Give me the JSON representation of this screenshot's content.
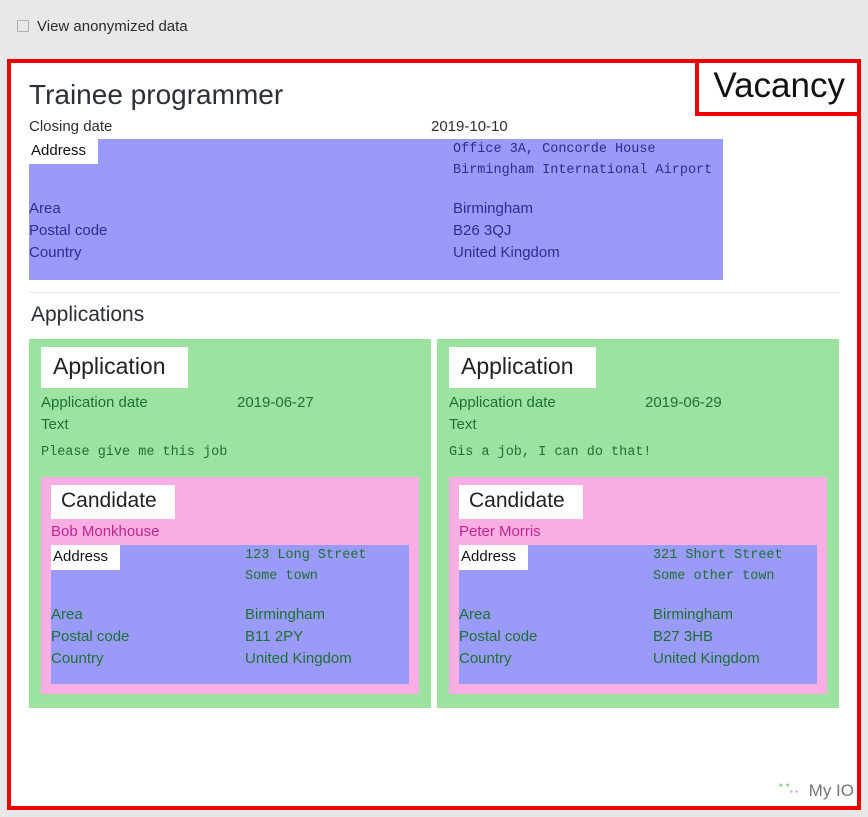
{
  "toolbar": {
    "anonymize_checkbox_label": "View anonymized data",
    "anonymize_checked": false
  },
  "colors": {
    "frame": "#ee0000",
    "address_block": "#9a9af8",
    "address_text": "#2d2d92",
    "application_block": "#9ce2a1",
    "application_text": "#1f7036",
    "candidate_block": "#fbaee4",
    "candidate_text": "#c0268f",
    "page_background": "#e8e8e8"
  },
  "vacancy": {
    "type_tag": "Vacancy",
    "title": "Trainee programmer",
    "closing_date_label": "Closing date",
    "closing_date_value": "2019-10-10",
    "address": {
      "section_label": "Address",
      "street_lines": [
        "Office 3A, Concorde House",
        "Birmingham International Airport"
      ],
      "area_label": "Area",
      "area_value": "Birmingham",
      "postal_code_label": "Postal code",
      "postal_code_value": "B26 3QJ",
      "country_label": "Country",
      "country_value": "United Kingdom"
    }
  },
  "applications_section": {
    "title": "Applications",
    "items": [
      {
        "type_tag": "Application",
        "date_label": "Application date",
        "date_value": "2019-06-27",
        "text_label": "Text",
        "text_value": "Please give me this job",
        "candidate": {
          "type_tag": "Candidate",
          "name": "Bob Monkhouse",
          "address": {
            "section_label": "Address",
            "street_lines": [
              "123 Long Street",
              "Some town"
            ],
            "area_label": "Area",
            "area_value": "Birmingham",
            "postal_code_label": "Postal code",
            "postal_code_value": "B11 2PY",
            "country_label": "Country",
            "country_value": "United Kingdom"
          }
        }
      },
      {
        "type_tag": "Application",
        "date_label": "Application date",
        "date_value": "2019-06-29",
        "text_label": "Text",
        "text_value": "Gis a job, I can do that!",
        "candidate": {
          "type_tag": "Candidate",
          "name": "Peter Morris",
          "address": {
            "section_label": "Address",
            "street_lines": [
              "321 Short Street",
              "Some other town"
            ],
            "area_label": "Area",
            "area_value": "Birmingham",
            "postal_code_label": "Postal code",
            "postal_code_value": "B27 3HB",
            "country_label": "Country",
            "country_value": "United Kingdom"
          }
        }
      }
    ]
  },
  "watermark": {
    "text": "My IO",
    "icon": "wechat-icon"
  }
}
